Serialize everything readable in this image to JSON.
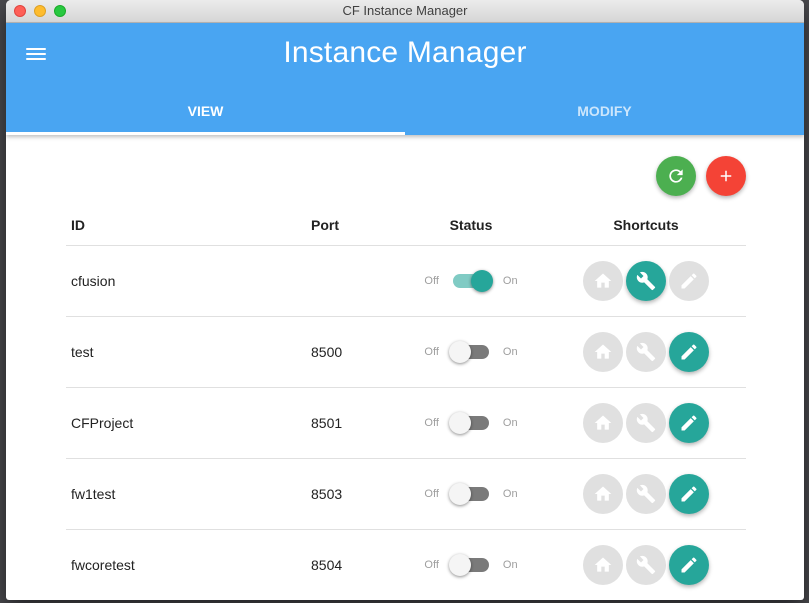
{
  "window": {
    "title": "CF Instance Manager"
  },
  "appbar": {
    "title": "Instance Manager",
    "menu_icon": "hamburger-menu-icon"
  },
  "tabs": [
    {
      "label": "VIEW",
      "active": true
    },
    {
      "label": "MODIFY",
      "active": false
    }
  ],
  "actions": {
    "refresh": {
      "icon": "refresh-icon",
      "color": "#4caf50"
    },
    "add": {
      "icon": "plus-icon",
      "color": "#f44336"
    }
  },
  "table": {
    "headers": {
      "id": "ID",
      "port": "Port",
      "status": "Status",
      "shortcuts": "Shortcuts"
    },
    "status_labels": {
      "off": "Off",
      "on": "On"
    },
    "rows": [
      {
        "id": "cfusion",
        "port": "",
        "on": true,
        "home": false,
        "admin": true,
        "edit": false
      },
      {
        "id": "test",
        "port": "8500",
        "on": false,
        "home": false,
        "admin": false,
        "edit": true
      },
      {
        "id": "CFProject",
        "port": "8501",
        "on": false,
        "home": false,
        "admin": false,
        "edit": true
      },
      {
        "id": "fw1test",
        "port": "8503",
        "on": false,
        "home": false,
        "admin": false,
        "edit": true
      },
      {
        "id": "fwcoretest",
        "port": "8504",
        "on": false,
        "home": false,
        "admin": false,
        "edit": true
      }
    ]
  },
  "colors": {
    "primary": "#49a5f2",
    "accent": "#26a69a",
    "disabled": "#e0e0e0"
  }
}
